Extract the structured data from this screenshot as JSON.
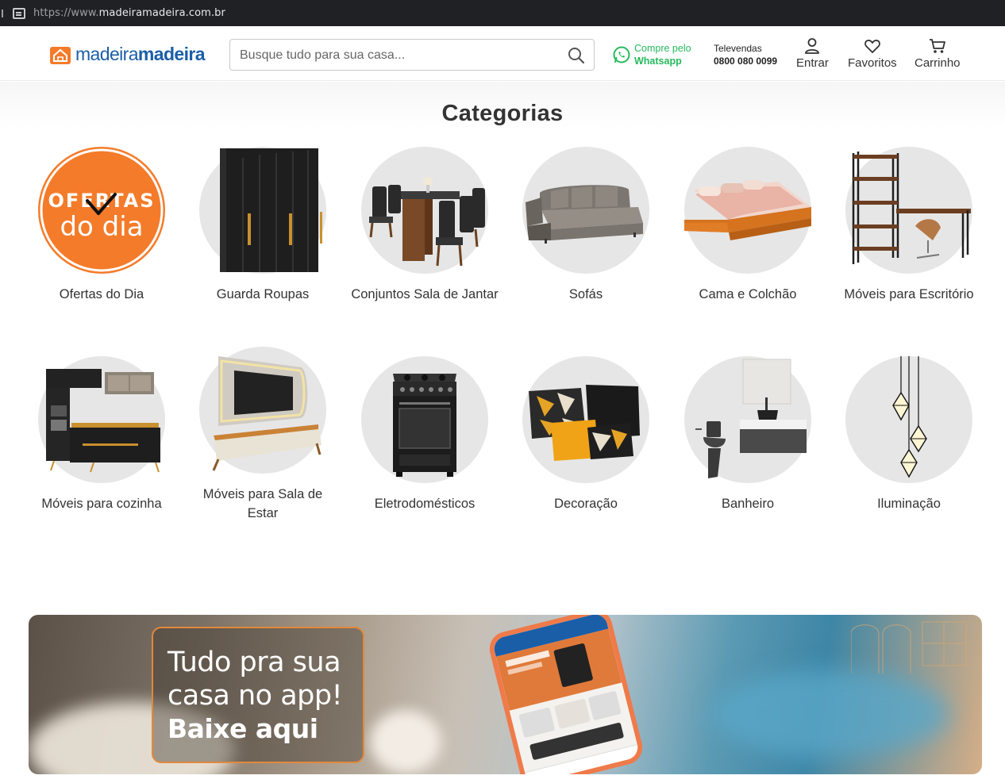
{
  "browser": {
    "url_prefix": "https://www.",
    "url_domain": "madeiramadeira.com.br"
  },
  "header": {
    "logo_part1": "madeira",
    "logo_part2": "madeira",
    "search_placeholder": "Busque tudo para sua casa...",
    "whatsapp_line1": "Compre pelo",
    "whatsapp_line2": "Whatsapp",
    "televendas_label": "Televendas",
    "televendas_phone": "0800 080 0099",
    "actions": {
      "login": "Entrar",
      "favorites": "Favoritos",
      "cart": "Carrinho"
    }
  },
  "categories": {
    "title": "Categorias",
    "items": [
      {
        "label": "Ofertas do Dia",
        "icon": "ofertas-do-dia-icon",
        "badge_line1": "OFERTAS",
        "badge_line2": "do dia"
      },
      {
        "label": "Guarda Roupas",
        "icon": "wardrobe-icon"
      },
      {
        "label": "Conjuntos Sala de Jantar",
        "icon": "dining-set-icon"
      },
      {
        "label": "Sofás",
        "icon": "sofa-icon"
      },
      {
        "label": "Cama e Colchão",
        "icon": "bed-icon"
      },
      {
        "label": "Móveis para Escritório",
        "icon": "office-furniture-icon"
      },
      {
        "label": "Móveis para cozinha",
        "icon": "kitchen-furniture-icon"
      },
      {
        "label": "Móveis para Sala de Estar",
        "icon": "living-room-icon"
      },
      {
        "label": "Eletrodomésticos",
        "icon": "stove-icon"
      },
      {
        "label": "Decoração",
        "icon": "cushions-icon"
      },
      {
        "label": "Banheiro",
        "icon": "bathroom-icon"
      },
      {
        "label": "Iluminação",
        "icon": "pendant-lamp-icon"
      }
    ]
  },
  "banner": {
    "line1": "Tudo pra sua",
    "line2": "casa no app!",
    "cta": "Baixe aqui"
  },
  "colors": {
    "brand_blue": "#1b5ea8",
    "brand_orange": "#f47b2a",
    "whatsapp_green": "#25b95d"
  }
}
